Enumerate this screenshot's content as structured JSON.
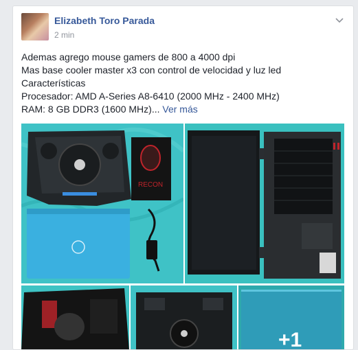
{
  "post": {
    "author": "Elizabeth Toro Parada",
    "time": "2 min",
    "text_lines": [
      "Ademas agrego mouse gamers de 800 a 4000 dpi",
      "Mas base cooler master x3 con control de velocidad y luz led",
      "Características",
      "Procesador: AMD A-Series A8-6410 (2000 MHz - 2400 MHz)",
      "RAM: 8 GB DDR3 (1600 MHz)..."
    ],
    "see_more": "Ver más",
    "more_photos": "+1",
    "photo_logo_text": "RECON"
  },
  "colors": {
    "link": "#365899",
    "background": "#e9ebee",
    "teal": "#3fc2c6",
    "laptop_blue": "#3ab0e0"
  }
}
